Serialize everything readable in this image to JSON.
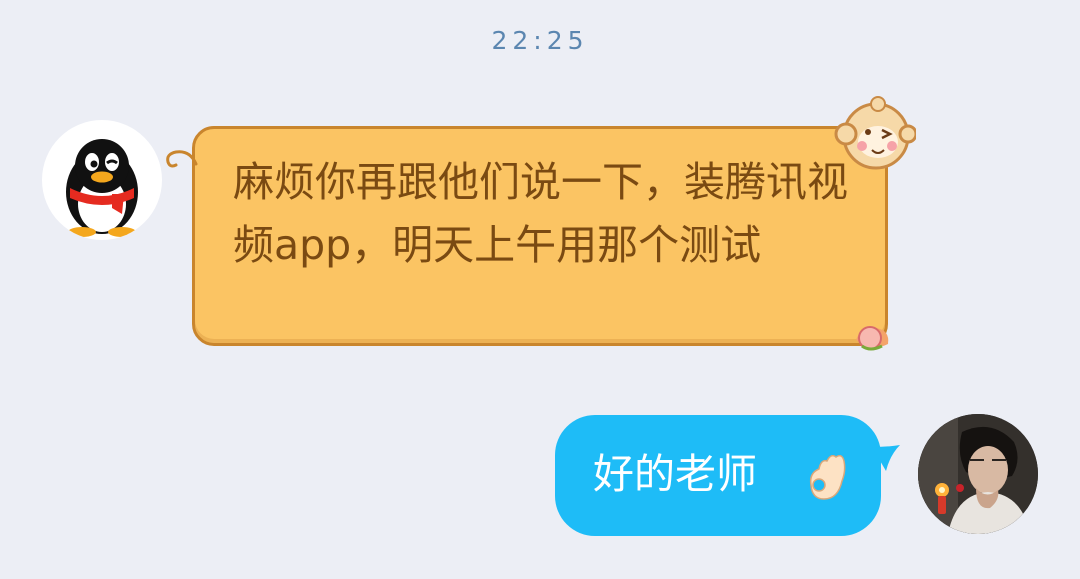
{
  "chat": {
    "timestamp": "22:25",
    "messages": [
      {
        "sender": "contact",
        "avatar_icon": "qq-penguin-icon",
        "text": "麻烦你再跟他们说一下，装腾讯视频app，明天上午用那个测试",
        "bubble_color": "#fbc463",
        "text_color": "#7a4a12"
      },
      {
        "sender": "me",
        "avatar_icon": "user-photo-avatar",
        "text": "好的老师",
        "emoji": "ok-hand-icon",
        "bubble_color": "#1ebcf7",
        "text_color": "#ffffff"
      }
    ]
  }
}
